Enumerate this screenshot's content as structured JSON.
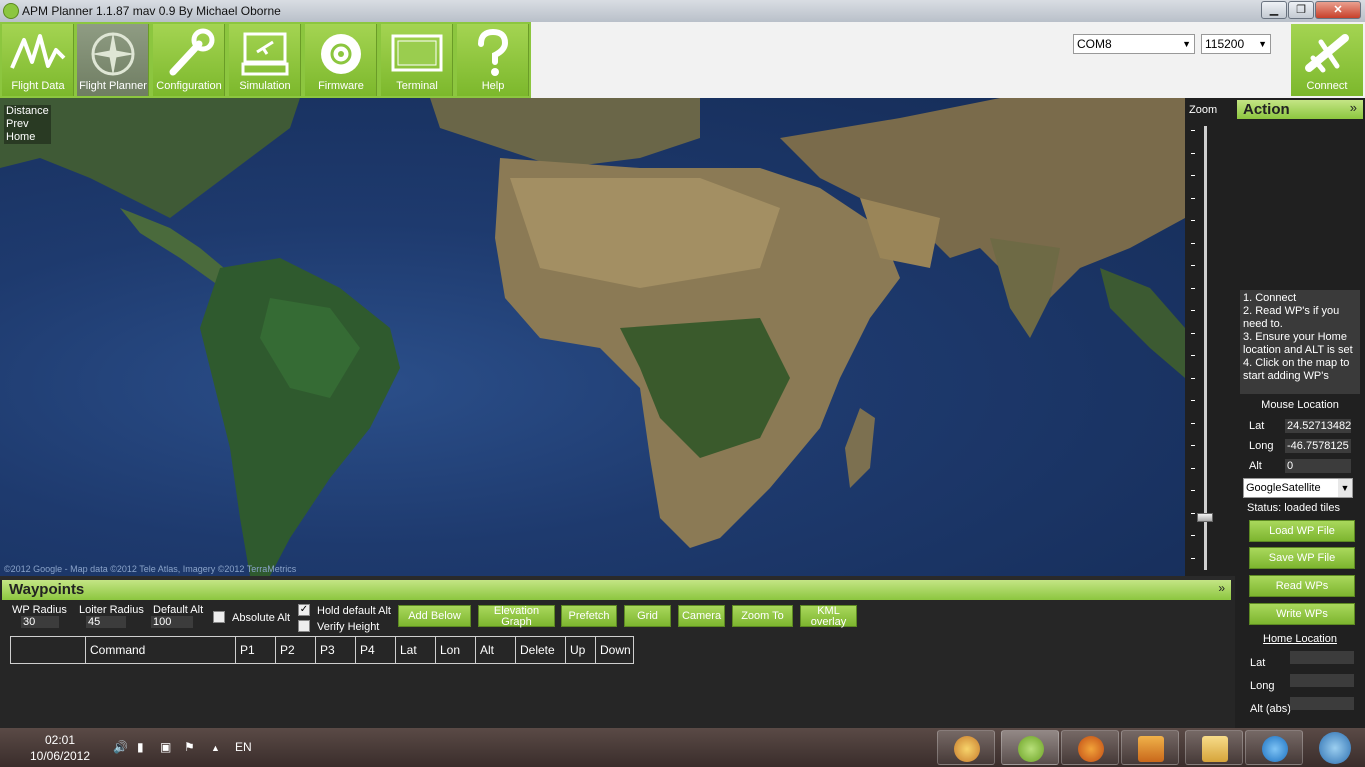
{
  "window": {
    "title": "APM Planner 1.1.87 mav 0.9 By Michael Oborne",
    "minimize": "▁",
    "maximize": "❐",
    "close": "✕"
  },
  "toolbar": {
    "items": [
      {
        "label": "Flight Data",
        "icon": "flight-data-icon"
      },
      {
        "label": "Flight Planner",
        "icon": "compass-icon"
      },
      {
        "label": "Configuration",
        "icon": "wrench-icon"
      },
      {
        "label": "Simulation",
        "icon": "simulation-icon"
      },
      {
        "label": "Firmware",
        "icon": "firmware-disc-icon"
      },
      {
        "label": "Terminal",
        "icon": "terminal-icon"
      },
      {
        "label": "Help",
        "icon": "help-icon"
      }
    ],
    "active": "Flight Planner",
    "port": "COM8",
    "baud": "115200",
    "connect_label": "Connect"
  },
  "map": {
    "overlay": [
      "Distance",
      "Prev",
      "Home"
    ],
    "credit": "©2012 Google - Map data ©2012 Tele Atlas, Imagery ©2012 TerraMetrics"
  },
  "zoom": {
    "label": "Zoom",
    "level_fraction": 0.06
  },
  "action": {
    "title": "Action",
    "collapse": "»",
    "instructions": [
      "1. Connect",
      "2. Read WP's if you need to.",
      "3. Ensure your Home location and ALT is set",
      "4. Click on the map to start adding WP's"
    ],
    "mouse_location_label": "Mouse Location",
    "lat_label": "Lat",
    "lat": "24.527134822",
    "long_label": "Long",
    "long": "-46.7578125",
    "alt_label": "Alt",
    "alt": "0",
    "map_type": "GoogleSatellite",
    "status": "Status: loaded tiles",
    "buttons": [
      "Load WP File",
      "Save WP File",
      "Read WPs",
      "Write WPs"
    ],
    "home_location_label": "Home Location",
    "home_lat_label": "Lat",
    "home_long_label": "Long",
    "home_alt_label": "Alt (abs)"
  },
  "waypoints": {
    "title": "Waypoints",
    "collapse": "»",
    "wp_radius_label": "WP Radius",
    "wp_radius": "30",
    "loiter_radius_label": "Loiter Radius",
    "loiter_radius": "45",
    "default_alt_label": "Default Alt",
    "default_alt": "100",
    "absolute_alt_label": "Absolute Alt",
    "hold_default_alt_label": "Hold default Alt",
    "verify_height_label": "Verify Height",
    "checkmark": "✓",
    "buttons": [
      "Add Below",
      "Elevation Graph",
      "Prefetch",
      "Grid",
      "Camera",
      "Zoom To",
      "KML overlay"
    ],
    "columns": [
      "",
      "Command",
      "P1",
      "P2",
      "P3",
      "P4",
      "Lat",
      "Lon",
      "Alt",
      "Delete",
      "Up",
      "Down"
    ]
  },
  "taskbar": {
    "time": "02:01",
    "date": "10/06/2012",
    "language": "EN",
    "tray_up": "▲"
  }
}
